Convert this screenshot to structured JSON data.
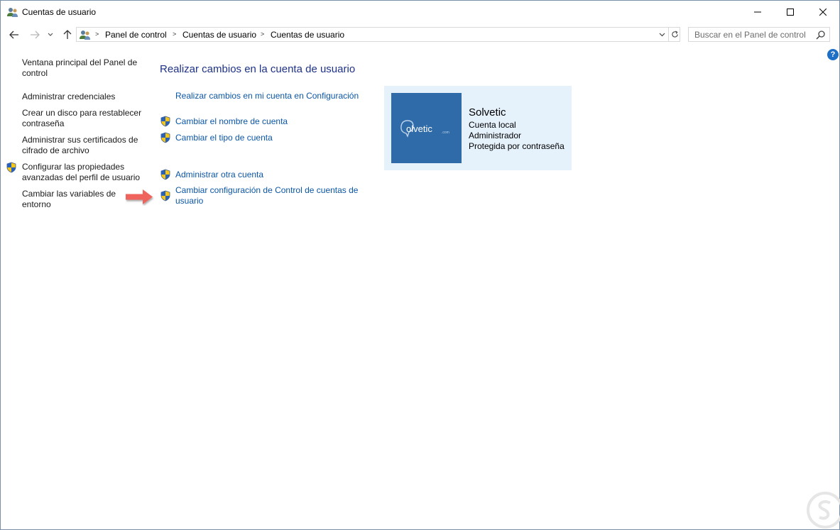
{
  "window": {
    "title": "Cuentas de usuario"
  },
  "addressbar": {
    "breadcrumbs": [
      "Panel de control",
      "Cuentas de usuario",
      "Cuentas de usuario"
    ]
  },
  "search": {
    "placeholder": "Buscar en el Panel de control"
  },
  "help": {
    "label": "?"
  },
  "sidebar": {
    "items": [
      {
        "label": "Ventana principal del Panel de control",
        "shield": false
      },
      {
        "label": "Administrar credenciales",
        "shield": false
      },
      {
        "label": "Crear un disco para restablecer contraseña",
        "shield": false
      },
      {
        "label": "Administrar sus certificados de cifrado de archivo",
        "shield": false
      },
      {
        "label": "Configurar las propiedades avanzadas del perfil de usuario",
        "shield": true
      },
      {
        "label": "Cambiar las variables de entorno",
        "shield": false
      }
    ]
  },
  "main": {
    "title": "Realizar cambios en la cuenta de usuario",
    "links": [
      {
        "label": "Realizar cambios en mi cuenta en Configuración",
        "shield": false
      },
      {
        "label": "Cambiar el nombre de cuenta",
        "shield": true
      },
      {
        "label": "Cambiar el tipo de cuenta",
        "shield": true
      },
      {
        "label": "Administrar otra cuenta",
        "shield": true
      },
      {
        "label": "Cambiar configuración de Control de cuentas de usuario",
        "shield": true
      }
    ]
  },
  "account": {
    "name": "Solvetic",
    "type": "Cuenta local",
    "role": "Administrador",
    "protection": "Protegida por contraseña",
    "avatar_logo": "olvetic"
  },
  "colors": {
    "link": "#0b56a6",
    "title": "#1e3287",
    "tile_bg": "#e5f1fb",
    "avatar_bg": "#2f6ba8",
    "arrow": "#f0645c"
  }
}
